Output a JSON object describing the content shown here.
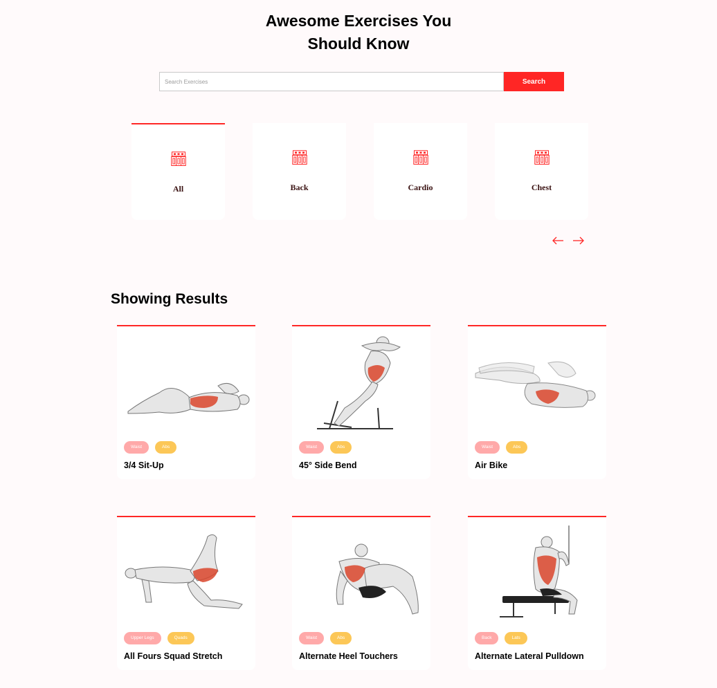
{
  "hero": {
    "title_line1": "Awesome Exercises You",
    "title_line2": "Should Know"
  },
  "search": {
    "placeholder": "Search Exercises",
    "value": "",
    "button_label": "Search"
  },
  "categories": {
    "icon": "gym-icon",
    "items": [
      {
        "label": "All",
        "active": true
      },
      {
        "label": "Back",
        "active": false
      },
      {
        "label": "Cardio",
        "active": false
      },
      {
        "label": "Chest",
        "active": false
      }
    ]
  },
  "pagination": {
    "prev_icon": "arrow-left-icon",
    "next_icon": "arrow-right-icon"
  },
  "results": {
    "title": "Showing Results",
    "cards": [
      {
        "name": "3/4 Sit-Up",
        "body_part": "Waist",
        "target": "Abs",
        "image": "sit-up-illustration"
      },
      {
        "name": "45° Side Bend",
        "body_part": "Waist",
        "target": "Abs",
        "image": "side-bend-illustration"
      },
      {
        "name": "Air Bike",
        "body_part": "Waist",
        "target": "Abs",
        "image": "air-bike-illustration"
      },
      {
        "name": "All Fours Squad Stretch",
        "body_part": "Upper Legs",
        "target": "Quads",
        "image": "squad-stretch-illustration"
      },
      {
        "name": "Alternate Heel Touchers",
        "body_part": "Waist",
        "target": "Abs",
        "image": "heel-touchers-illustration"
      },
      {
        "name": "Alternate Lateral Pulldown",
        "body_part": "Back",
        "target": "Lats",
        "image": "lateral-pulldown-illustration"
      }
    ]
  },
  "colors": {
    "accent": "#ff2625",
    "tag_body_part": "#ffa9a9",
    "tag_target": "#fcc757",
    "background": "#fffafb"
  }
}
